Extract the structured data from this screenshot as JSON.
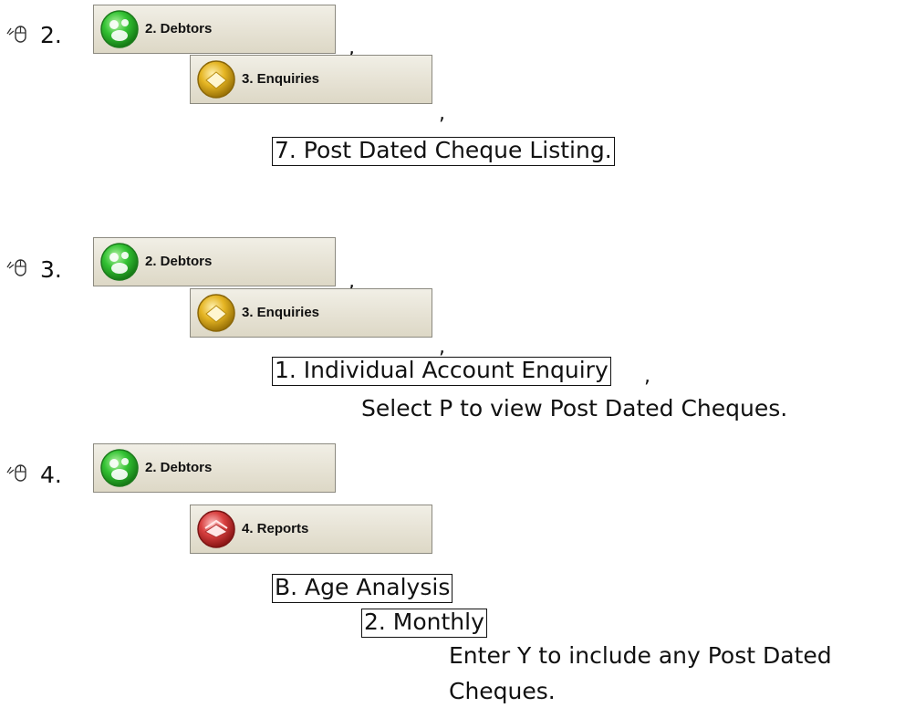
{
  "steps": [
    {
      "num": "2.",
      "debtors_label": "2. Debtors",
      "sub_label": "3. Enquiries",
      "item": "7. Post Dated Cheque Listing."
    },
    {
      "num": "3.",
      "debtors_label": "2. Debtors",
      "sub_label": "3. Enquiries",
      "item": "1. Individual Account Enquiry",
      "note": "Select P to view Post Dated Cheques."
    },
    {
      "num": "4.",
      "debtors_label": "2. Debtors",
      "sub_label": "4. Reports",
      "item": "B. Age Analysis",
      "subitem": "2. Monthly",
      "note_line1": "Enter Y to include any Post Dated",
      "note_line2": "Cheques."
    }
  ],
  "punct": {
    "comma": ","
  },
  "colors": {
    "debtors": "#2fb52f",
    "enquiries": "#d9a917",
    "reports": "#c93434"
  },
  "icons": {
    "step": "mouse-click-icon",
    "debtors": "debtors-orb-icon",
    "enquiries": "enquiries-orb-icon",
    "reports": "reports-orb-icon"
  }
}
